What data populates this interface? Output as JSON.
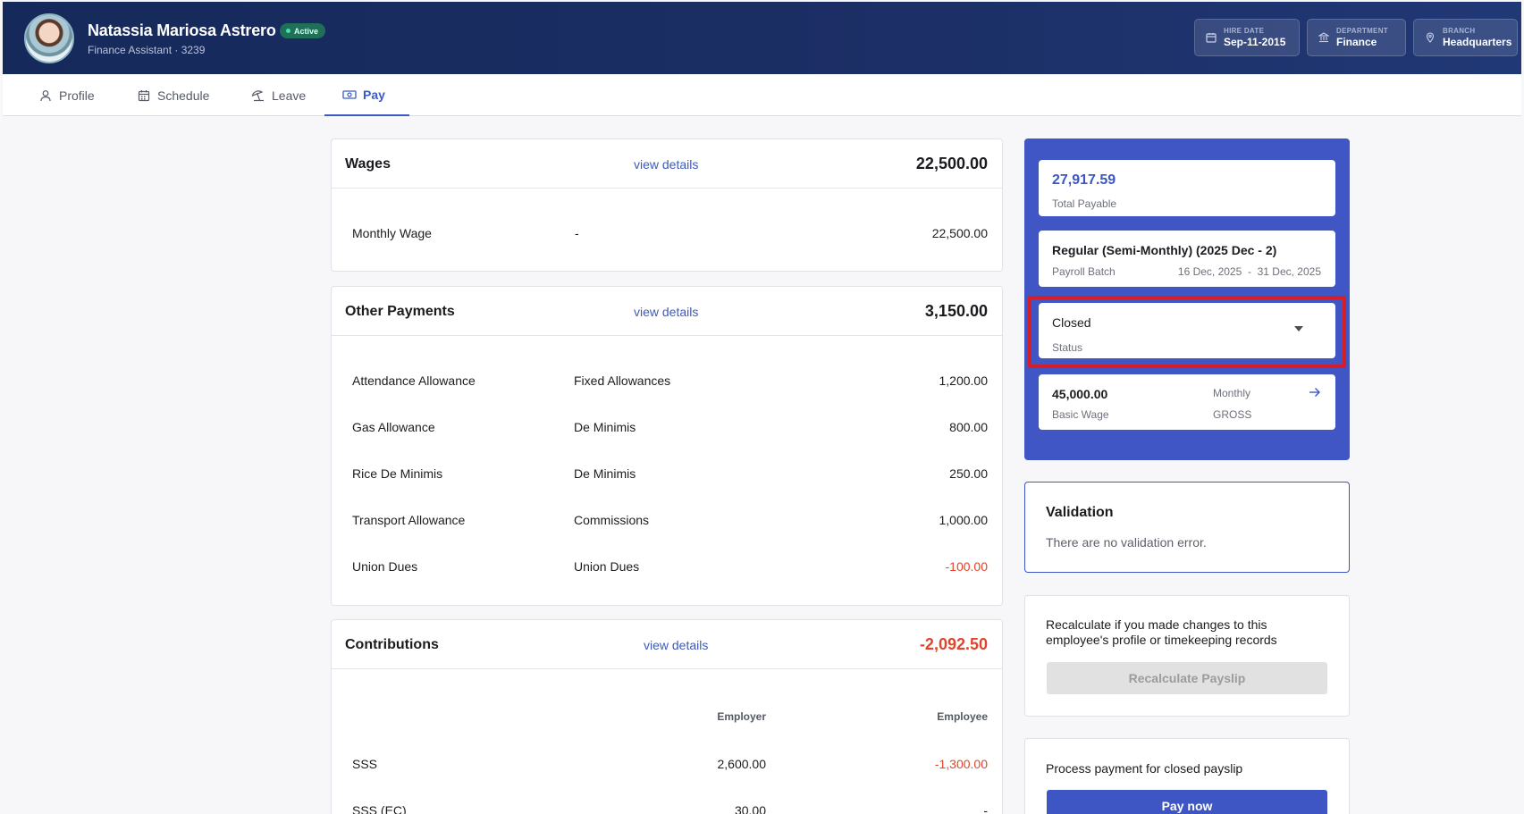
{
  "employee": {
    "name": "Natassia Mariosa Astrero",
    "status": "Active",
    "subtitle": "Finance Assistant · 3239"
  },
  "info": {
    "hire_date_label": "HIRE DATE",
    "hire_date": "Sep-11-2015",
    "department_label": "DEPARTMENT",
    "department": "Finance",
    "branch_label": "BRANCH",
    "branch": "Headquarters"
  },
  "tabs": [
    {
      "label": "Profile",
      "icon": "person-icon"
    },
    {
      "label": "Schedule",
      "icon": "calendar-icon"
    },
    {
      "label": "Leave",
      "icon": "beach-umbrella-icon"
    },
    {
      "label": "Pay",
      "icon": "cash-icon",
      "active": true
    }
  ],
  "wages": {
    "title": "Wages",
    "link": "view details",
    "total": "22,500.00",
    "rows": [
      {
        "name": "Monthly Wage",
        "type": "-",
        "amount": "22,500.00"
      }
    ]
  },
  "other_payments": {
    "title": "Other Payments",
    "link": "view details",
    "total": "3,150.00",
    "rows": [
      {
        "name": "Attendance Allowance",
        "type": "Fixed Allowances",
        "amount": "1,200.00"
      },
      {
        "name": "Gas Allowance",
        "type": "De Minimis",
        "amount": "800.00"
      },
      {
        "name": "Rice De Minimis",
        "type": "De Minimis",
        "amount": "250.00"
      },
      {
        "name": "Transport Allowance",
        "type": "Commissions",
        "amount": "1,000.00"
      },
      {
        "name": "Union Dues",
        "type": "Union Dues",
        "amount": "-100.00"
      }
    ]
  },
  "contributions": {
    "title": "Contributions",
    "link": "view details",
    "total": "-2,092.50",
    "col_employer": "Employer",
    "col_employee": "Employee",
    "rows": [
      {
        "name": "SSS",
        "employer": "2,600.00",
        "employee": "-1,300.00"
      },
      {
        "name": "SSS (EC)",
        "employer": "30.00",
        "employee": "-"
      }
    ]
  },
  "summary": {
    "total_payable": "27,917.59",
    "total_payable_label": "Total Payable",
    "batch_name": "Regular (Semi-Monthly) (2025 Dec - 2)",
    "batch_label": "Payroll Batch",
    "batch_range": "16 Dec, 2025  -  31 Dec, 2025",
    "status_value": "Closed",
    "status_label": "Status",
    "basic_wage": "45,000.00",
    "basic_wage_label": "Basic Wage",
    "wage_period": "Monthly",
    "wage_kind": "GROSS"
  },
  "validation": {
    "title": "Validation",
    "message": "There are no validation error."
  },
  "recalculate": {
    "text": "Recalculate if you made changes to this employee's profile or timekeeping records",
    "button": "Recalculate Payslip"
  },
  "payment": {
    "text": "Process payment for closed payslip",
    "button": "Pay now"
  },
  "colors": {
    "header": "#1c2f66",
    "accent": "#3d56c3",
    "negative": "#e0452b",
    "highlight": "#d61d2a"
  }
}
